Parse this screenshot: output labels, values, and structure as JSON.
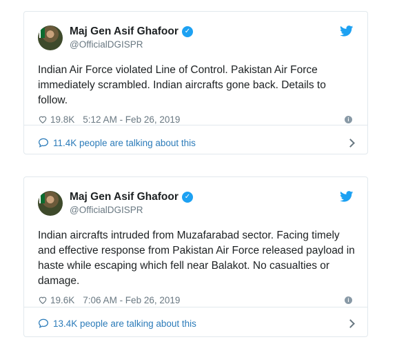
{
  "tweets": [
    {
      "author": {
        "name": "Maj Gen Asif Ghafoor",
        "handle": "@OfficialDGISPR"
      },
      "text": "Indian Air Force violated Line of Control. Pakistan Air Force immediately scrambled. Indian aircrafts gone back. Details to follow.",
      "likes": "19.8K",
      "timestamp": "5:12 AM - Feb 26, 2019",
      "talking": "11.4K people are talking about this"
    },
    {
      "author": {
        "name": "Maj Gen Asif Ghafoor",
        "handle": "@OfficialDGISPR"
      },
      "text": "Indian aircrafts intruded from Muzafarabad sector. Facing timely and effective response from Pakistan Air Force released payload in haste while escaping which fell near Balakot. No casualties or damage.",
      "likes": "19.6K",
      "timestamp": "7:06 AM - Feb 26, 2019",
      "talking": "13.4K people are talking about this"
    }
  ],
  "colors": {
    "twitter_blue": "#1da1f2",
    "link_blue": "#2b7bb9",
    "muted": "#697882",
    "border": "#e1e8ed"
  },
  "icons": [
    "avatar",
    "verified-badge-icon",
    "twitter-bird-icon",
    "heart-icon",
    "info-icon",
    "speech-bubble-icon",
    "chevron-right-icon"
  ]
}
